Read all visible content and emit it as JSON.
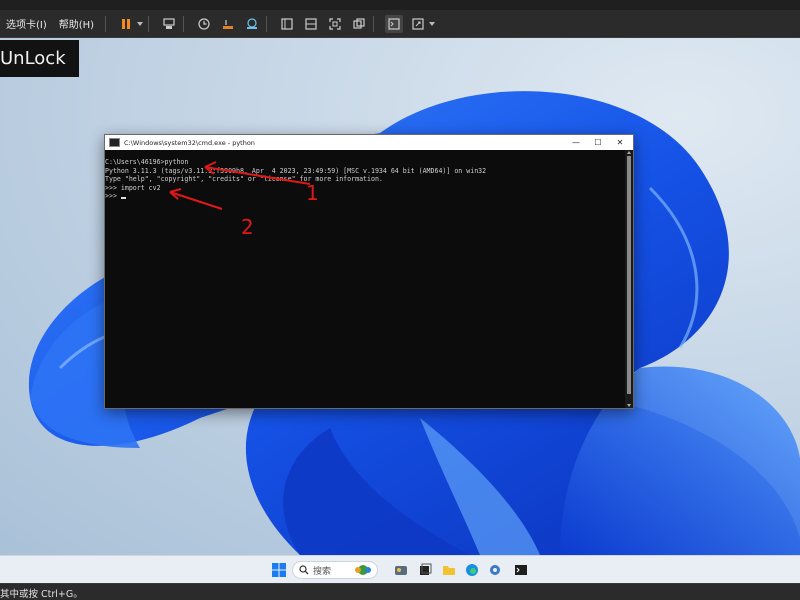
{
  "host_toolbar": {
    "menus": [
      "选项卡(I)",
      "帮助(H)"
    ]
  },
  "overlay_label": "UnLock",
  "cmd_window": {
    "title": "C:\\Windows\\system32\\cmd.exe - python",
    "controls": {
      "minimize": "—",
      "maximize": "☐",
      "close": "✕"
    },
    "lines": [
      "C:\\Users\\46196>python",
      "Python 3.11.3 (tags/v3.11.3:f3909b8, Apr  4 2023, 23:49:59) [MSC v.1934 64 bit (AMD64)] on win32",
      "Type \"help\", \"copyright\", \"credits\" or \"license\" for more information.",
      ">>> import cv2",
      ">>> "
    ]
  },
  "annotations": {
    "first": "1",
    "second": "2",
    "color": "#e01818"
  },
  "taskbar": {
    "search_placeholder": "搜索"
  },
  "status_bar": {
    "text": "其中或按 Ctrl+G。"
  },
  "colors": {
    "accent_blue": "#1a5fe0",
    "terminal_bg": "#0c0c0c",
    "terminal_text": "#cfcfcf"
  },
  "icons": {
    "toolbar": [
      "pause-icon",
      "send-keys-icon",
      "snapshot-icon",
      "revert-icon",
      "manage-snapshots-icon",
      "console-view-icon",
      "split-view-icon",
      "fullscreen-icon",
      "unity-icon",
      "terminal-icon",
      "stretch-icon"
    ],
    "taskbar": [
      "windows-start-icon",
      "search-icon",
      "widgets-icon",
      "task-view-icon",
      "file-explorer-icon",
      "edge-icon",
      "settings-icon",
      "store-icon",
      "terminal-icon"
    ]
  }
}
